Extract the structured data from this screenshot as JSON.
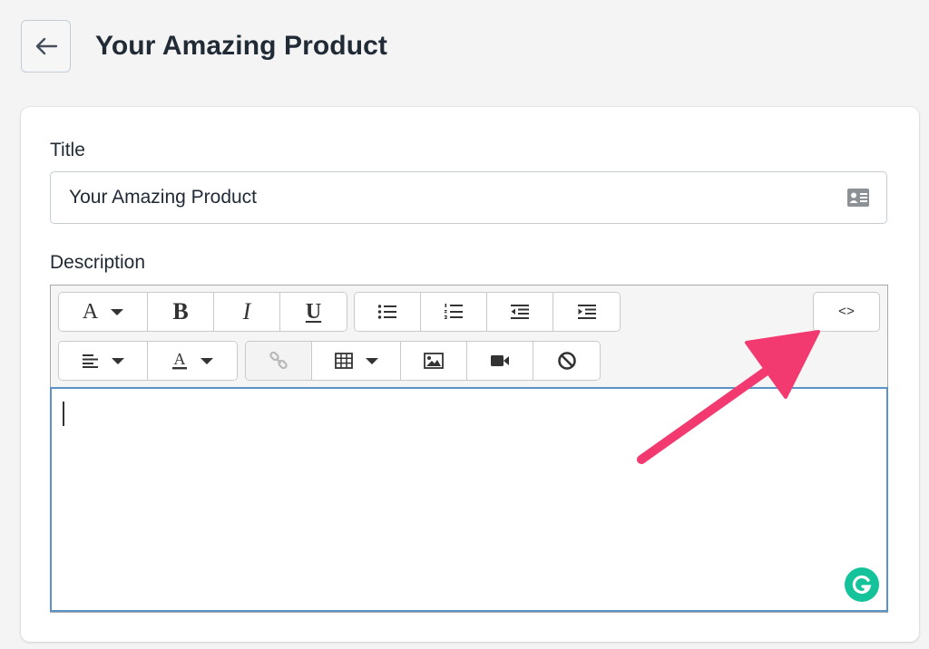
{
  "header": {
    "back_icon": "arrow-left-icon",
    "title": "Your Amazing Product"
  },
  "form": {
    "title_label": "Title",
    "title_value": "Your Amazing Product",
    "title_icon": "contact-card-icon",
    "description_label": "Description"
  },
  "toolbar": {
    "row1": [
      {
        "name": "font-style-dropdown",
        "glyph": "A",
        "dropdown": true
      },
      {
        "name": "bold-button",
        "glyph": "B"
      },
      {
        "name": "italic-button",
        "glyph": "I"
      },
      {
        "name": "underline-button",
        "glyph": "U"
      },
      {
        "name": "unordered-list-button",
        "icon": "bullet-list-icon"
      },
      {
        "name": "ordered-list-button",
        "icon": "numbered-list-icon"
      },
      {
        "name": "outdent-button",
        "icon": "outdent-icon"
      },
      {
        "name": "indent-button",
        "icon": "indent-icon"
      }
    ],
    "row2": [
      {
        "name": "align-dropdown",
        "icon": "align-left-icon",
        "dropdown": true
      },
      {
        "name": "text-color-dropdown",
        "icon": "text-color-icon",
        "dropdown": true
      },
      {
        "name": "link-button",
        "icon": "link-icon",
        "disabled": true
      },
      {
        "name": "table-dropdown",
        "icon": "table-icon",
        "dropdown": true
      },
      {
        "name": "insert-image-button",
        "icon": "image-icon"
      },
      {
        "name": "insert-video-button",
        "icon": "video-icon"
      },
      {
        "name": "clear-formatting-button",
        "icon": "block-icon"
      }
    ],
    "code_view_label": "<>"
  },
  "editor": {
    "content": "",
    "grammarly_icon": "grammarly-icon"
  },
  "colors": {
    "annotation_arrow": "#f23a70",
    "grammarly": "#15c39a",
    "editor_focus_border": "#5b93c9"
  }
}
